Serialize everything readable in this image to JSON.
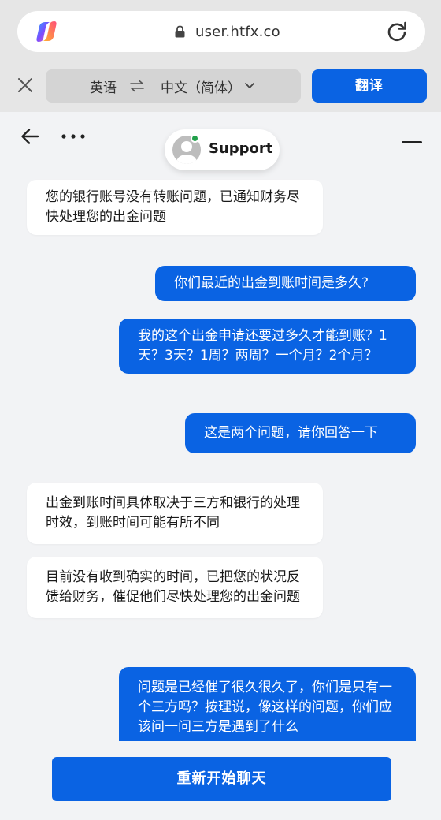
{
  "browser": {
    "url": "user.htfx.co",
    "icons": {
      "logo": "copilot-logo",
      "lock": "lock-icon",
      "reload": "reload-icon"
    }
  },
  "translate_bar": {
    "source_lang": "英语",
    "target_lang": "中文（简体）",
    "button_label": "翻译",
    "icons": {
      "close": "close-icon",
      "swap": "swap-arrows-icon",
      "dropdown": "chevron-down-icon"
    }
  },
  "chat_header": {
    "agent_name": "Support",
    "status_color": "#22a04b",
    "icons": {
      "back": "back-arrow-icon",
      "more": "more-dots-icon",
      "minimize": "minimize-icon"
    }
  },
  "messages": [
    {
      "from": "agent",
      "text": "您的银行账号没有转账问题，已通知财务尽快处理您的出金问题"
    },
    {
      "from": "user",
      "text": "你们最近的出金到账时间是多久?"
    },
    {
      "from": "user",
      "text": "我的这个出金申请还要过多久才能到账？1天？3天？1周？两周？一个月？2个月？"
    },
    {
      "from": "user",
      "text": "这是两个问题，请你回答一下"
    },
    {
      "from": "agent",
      "text": "出金到账时间具体取决于三方和银行的处理时效，到账时间可能有所不同"
    },
    {
      "from": "agent",
      "text": "目前没有收到确实的时间，已把您的状况反馈给财务，催促他们尽快处理您的出金问题"
    },
    {
      "from": "user",
      "text": "问题是已经催了很久很久了，你们是只有一个三方吗？按理说，像这样的问题，你们应该问一问三方是遇到了什么"
    }
  ],
  "footer": {
    "restart_label": "重新开始聊天"
  },
  "colors": {
    "accent": "#0a63e3",
    "chat_bg": "#f2f3f5",
    "toolbar_bg": "#e6e6e6"
  }
}
